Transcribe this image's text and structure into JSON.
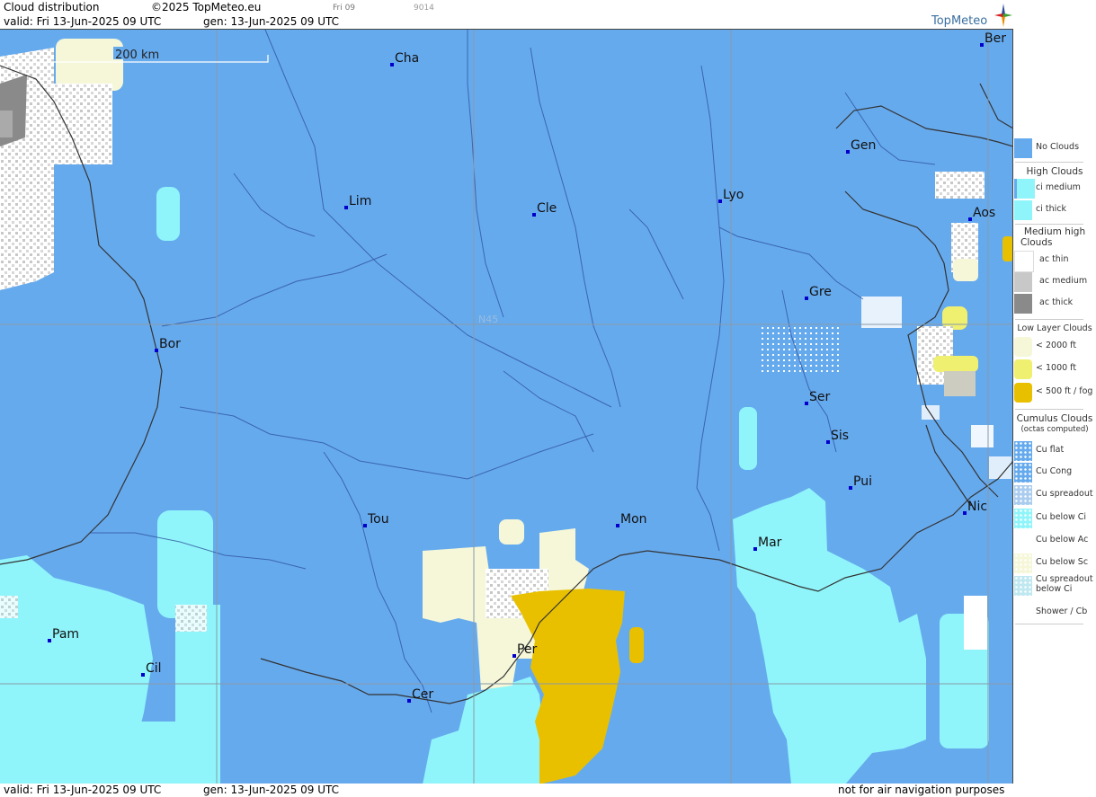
{
  "header": {
    "title": "Cloud distribution",
    "copyright": "©2025 TopMeteo.eu",
    "frame": "Fri 09",
    "code": "9014",
    "valid": "valid:  Fri  13-Jun-2025  09 UTC",
    "gen": "gen: 13-Jun-2025 09 UTC",
    "brand": "TopMeteo"
  },
  "footer": {
    "valid": "valid:  Fri  13-Jun-2025  09 UTC",
    "gen": "gen: 13-Jun-2025 09 UTC",
    "disclaimer": "not for air navigation purposes"
  },
  "map": {
    "scale_label": "200 km",
    "gridline_label": "N45",
    "cities": [
      {
        "id": "cha",
        "label": "Cha"
      },
      {
        "id": "ber",
        "label": "Ber"
      },
      {
        "id": "gen",
        "label": "Gen"
      },
      {
        "id": "lim",
        "label": "Lim"
      },
      {
        "id": "cle",
        "label": "Cle"
      },
      {
        "id": "lyo",
        "label": "Lyo"
      },
      {
        "id": "aos",
        "label": "Aos"
      },
      {
        "id": "gre",
        "label": "Gre"
      },
      {
        "id": "bor",
        "label": "Bor"
      },
      {
        "id": "ser",
        "label": "Ser"
      },
      {
        "id": "sis",
        "label": "Sis"
      },
      {
        "id": "pui",
        "label": "Pui"
      },
      {
        "id": "tou",
        "label": "Tou"
      },
      {
        "id": "mon",
        "label": "Mon"
      },
      {
        "id": "nic",
        "label": "Nic"
      },
      {
        "id": "mar",
        "label": "Mar"
      },
      {
        "id": "pam",
        "label": "Pam"
      },
      {
        "id": "per",
        "label": "Per"
      },
      {
        "id": "cil",
        "label": "Cil"
      },
      {
        "id": "cer",
        "label": "Cer"
      }
    ]
  },
  "legend": {
    "no_clouds": "No Clouds",
    "high_head": "High Clouds",
    "high": [
      "ci medium",
      "ci thick"
    ],
    "medium_head_1": "Medium high",
    "medium_head_2": "Clouds",
    "medium": [
      "ac thin",
      "ac medium",
      "ac thick"
    ],
    "low_head": "Low Layer Clouds",
    "low": [
      "< 2000 ft",
      "< 1000 ft",
      "< 500 ft / fog"
    ],
    "cu_head_1": "Cumulus Clouds",
    "cu_head_2": "(octas computed)",
    "cu": [
      "Cu flat",
      "Cu Cong",
      "Cu spreadout",
      "Cu below Ci",
      "Cu below Ac",
      "Cu below Sc",
      "Cu spreadout",
      "Shower / Cb"
    ],
    "cu_extra": "below Ci"
  },
  "colors": {
    "sea_land_no_cloud": "#66aaee",
    "ci_medium": "#8ff5fa",
    "low_2000": "#f5f7d8",
    "low_1000": "#f0f070",
    "fog": "#e8c000",
    "ac_medium": "#c8c8c8",
    "ac_thick": "#8a8a8a",
    "city_marker": "#0000cc"
  }
}
